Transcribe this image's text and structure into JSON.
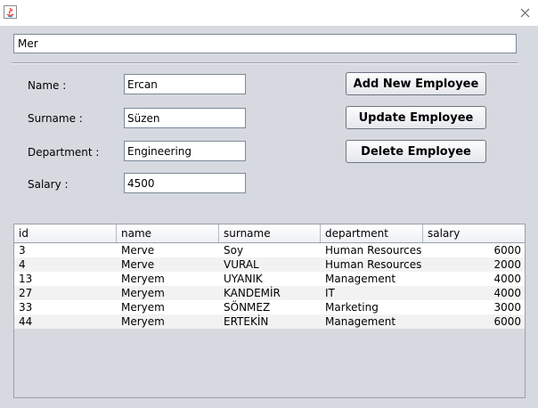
{
  "window": {
    "close_glyph": "×"
  },
  "search": {
    "value": "Mer"
  },
  "form": {
    "name_label": "Name :",
    "name_value": "Ercan",
    "surname_label": "Surname :",
    "surname_value": "Süzen",
    "department_label": "Department :",
    "department_value": "Engineering",
    "salary_label": "Salary :",
    "salary_value": "4500"
  },
  "buttons": {
    "add": "Add  New Employee",
    "update": "Update Employee",
    "delete": "Delete Employee"
  },
  "table": {
    "columns": [
      "id",
      "name",
      "surname",
      "department",
      "salary"
    ],
    "rows": [
      [
        "3",
        "Merve",
        "Soy",
        "Human Resources",
        "6000"
      ],
      [
        "4",
        "Merve",
        "VURAL",
        "Human Resources",
        "2000"
      ],
      [
        "13",
        "Meryem",
        "UYANIK",
        "Management",
        "4000"
      ],
      [
        "27",
        "Meryem",
        "KANDEMİR",
        "IT",
        "4000"
      ],
      [
        "33",
        "Meryem",
        "SÖNMEZ",
        "Marketing",
        "3000"
      ],
      [
        "44",
        "Meryem",
        "ERTEKİN",
        "Management",
        "6000"
      ]
    ]
  }
}
